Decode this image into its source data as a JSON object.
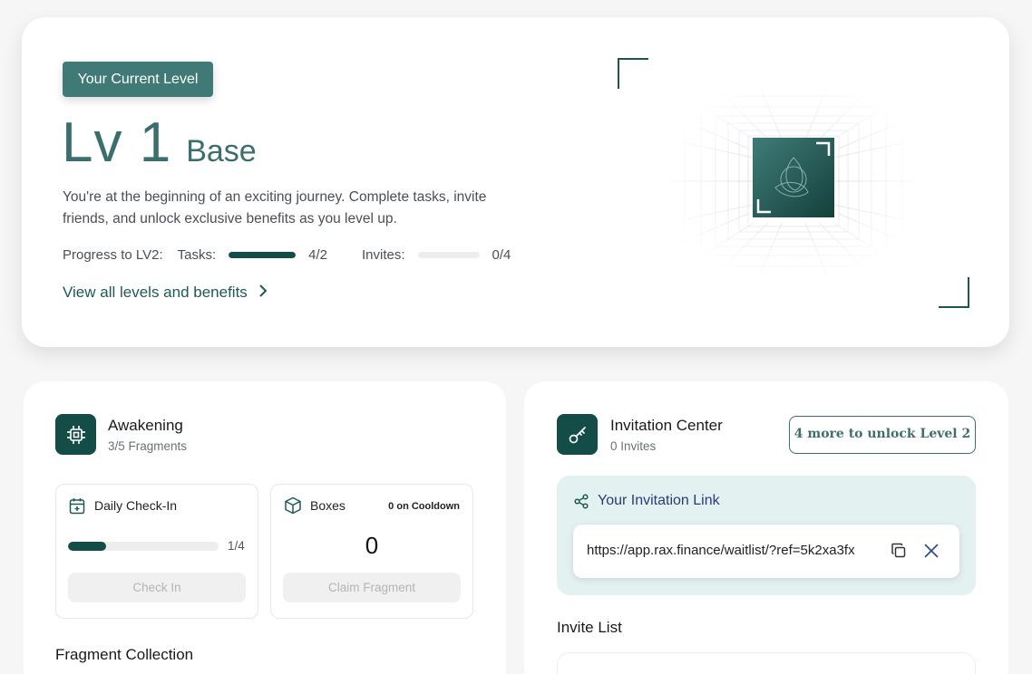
{
  "hero": {
    "badge": "Your Current Level",
    "level_number": "Lv 1",
    "level_name": "Base",
    "description": "You're at the beginning of an exciting journey. Complete tasks, invite friends, and unlock exclusive benefits as you level up.",
    "progress_label": "Progress to LV2:",
    "tasks_label": "Tasks:",
    "tasks_value": "4/2",
    "tasks_progress": 1.0,
    "invites_label": "Invites:",
    "invites_value": "0/4",
    "invites_progress": 0.0,
    "view_link": "View all levels and benefits",
    "accent_color": "#144d47"
  },
  "awakening": {
    "title": "Awakening",
    "subtitle": "3/5 Fragments",
    "daily": {
      "title": "Daily Check-In",
      "progress_value": "1/4",
      "progress": 0.25,
      "button": "Check In"
    },
    "boxes": {
      "title": "Boxes",
      "cooldown": "0 on Cooldown",
      "count": "0",
      "button": "Claim Fragment"
    },
    "fragment_collection": "Fragment Collection"
  },
  "invitation": {
    "title": "Invitation Center",
    "subtitle": "0 Invites",
    "unlock_button": "4 more to unlock Level 2",
    "link_title": "Your Invitation Link",
    "link_url": "https://app.rax.finance/waitlist/?ref=5k2xa3fx",
    "invite_list": "Invite List"
  }
}
